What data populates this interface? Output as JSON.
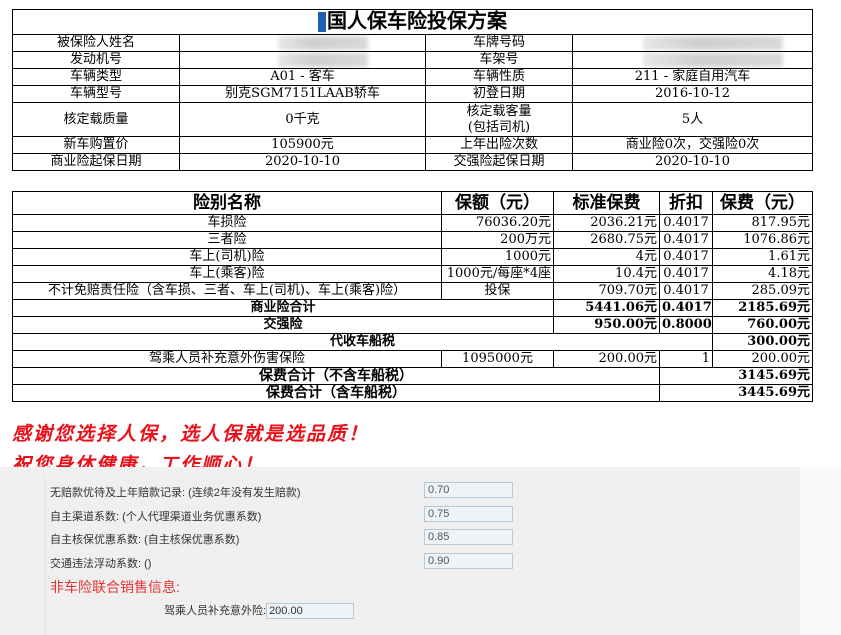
{
  "title": "国人保车险投保方案",
  "info": {
    "rows": [
      {
        "l1": "被保险人姓名",
        "v1": "",
        "l2": "车牌号码",
        "v2": ""
      },
      {
        "l1": "发动机号",
        "v1": "",
        "l2": "车架号",
        "v2": ""
      },
      {
        "l1": "车辆类型",
        "v1": "A01 - 客车",
        "l2": "车辆性质",
        "v2": "211 - 家庭自用汽车"
      },
      {
        "l1": "车辆型号",
        "v1": "别克SGM7151LAAB轿车",
        "l2": "初登日期",
        "v2": "2016-10-12"
      },
      {
        "l1": "核定载质量",
        "v1": "0千克",
        "l2": "核定载客量\n(包括司机)",
        "v2": "5人"
      },
      {
        "l1": "新车购置价",
        "v1": "105900元",
        "l2": "上年出险次数",
        "v2": "商业险0次，交强险0次"
      },
      {
        "l1": "商业险起保日期",
        "v1": "2020-10-10",
        "l2": "交强险起保日期",
        "v2": "2020-10-10"
      }
    ]
  },
  "premium": {
    "headers": [
      "险别名称",
      "保额（元）",
      "标准保费",
      "折扣",
      "保费（元）"
    ],
    "rows": [
      [
        "车损险",
        "76036.20元",
        "2036.21元",
        "0.4017",
        "817.95元"
      ],
      [
        "三者险",
        "200万元",
        "2680.75元",
        "0.4017",
        "1076.86元"
      ],
      [
        "车上(司机)险",
        "1000元",
        "4元",
        "0.4017",
        "1.61元"
      ],
      [
        "车上(乘客)险",
        "1000元/每座*4座",
        "10.4元",
        "0.4017",
        "4.18元"
      ],
      [
        "不计免赔责任险（含车损、三者、车上(司机)、车上(乘客)险）",
        "投保",
        "709.70元",
        "0.4017",
        "285.09元"
      ]
    ],
    "commercial_total": {
      "label": "商业险合计",
      "std": "5441.06元",
      "disc": "0.4017",
      "fee": "2185.69元"
    },
    "compulsory": {
      "label": "交强险",
      "std": "950.00元",
      "disc": "0.8000",
      "fee": "760.00元"
    },
    "vehicle_tax": {
      "label": "代收车船税",
      "fee": "300.00元"
    },
    "accident": {
      "label": "驾乘人员补充意外伤害保险",
      "amount": "1095000元",
      "std": "200.00元",
      "disc": "1",
      "fee": "200.00元"
    },
    "total_ex_tax": {
      "label": "保费合计（不含车船税）",
      "fee": "3145.69元"
    },
    "total_in_tax": {
      "label": "保费合计（含车船税）",
      "fee": "3445.69元"
    }
  },
  "slogans": [
    "感谢您选择人保，选人保就是选品质！",
    "祝您身体健康，工作顺心！"
  ],
  "form": {
    "fields": [
      {
        "label": "无赔款优待及上年赔款记录: (连续2年没有发生赔款)",
        "value": "0.70"
      },
      {
        "label": "自主渠道系数: (个人代理渠道业务优惠系数)",
        "value": "0.75"
      },
      {
        "label": "自主核保优惠系数: (自主核保优惠系数)",
        "value": "0.85"
      },
      {
        "label": "交通违法浮动系数: ()",
        "value": "0.90"
      }
    ],
    "section_title": "非车险联合销售信息:",
    "sub_label": "驾乘人员补充意外险:",
    "sub_value": "200.00"
  },
  "colors": {
    "slogan": "#e8111b",
    "section": "#e53333"
  }
}
